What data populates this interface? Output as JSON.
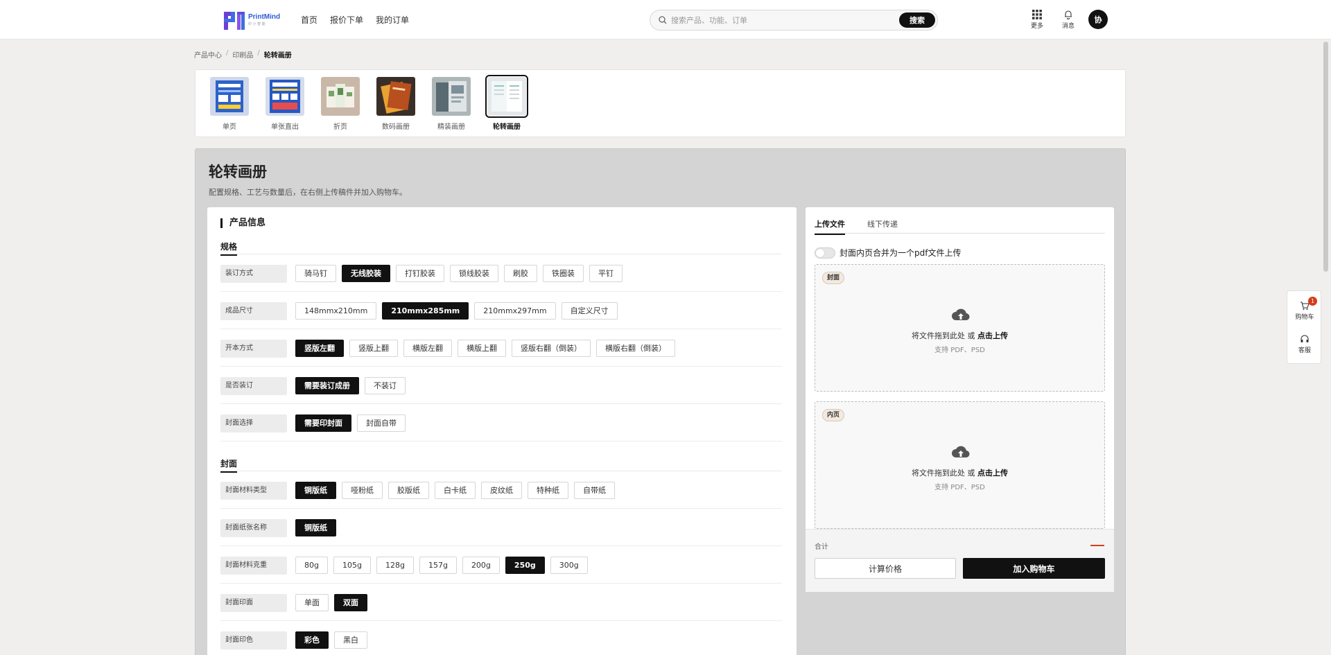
{
  "brand": {
    "name": "PrintMind",
    "tagline": "印 小 智 能"
  },
  "nav": [
    "首页",
    "报价下单",
    "我的订单"
  ],
  "search": {
    "placeholder": "搜索产品、功能、订单",
    "button": "搜索"
  },
  "header_tools": {
    "more": "更多",
    "messages": "消息",
    "avatar": "协"
  },
  "breadcrumb": [
    "产品中心",
    "印刷品",
    "轮转画册"
  ],
  "categories": [
    {
      "label": "单页"
    },
    {
      "label": "单张直出"
    },
    {
      "label": "折页"
    },
    {
      "label": "数码画册"
    },
    {
      "label": "精装画册"
    },
    {
      "label": "轮转画册",
      "active": true
    }
  ],
  "page": {
    "title": "轮转画册",
    "subtitle": "配置规格、工艺与数量后，在右侧上传稿件并加入购物车。"
  },
  "product_info": {
    "title": "产品信息",
    "groups": [
      {
        "title": "规格",
        "rows": [
          {
            "label": "装订方式",
            "options": [
              "骑马钉",
              "无线胶装",
              "打钉胶装",
              "锁线胶装",
              "刷胶",
              "铁圈装",
              "平钉"
            ],
            "selected": 1
          },
          {
            "label": "成品尺寸",
            "options": [
              "148mmx210mm",
              "210mmx285mm",
              "210mmx297mm",
              "自定义尺寸"
            ],
            "selected": 1
          },
          {
            "label": "开本方式",
            "options": [
              "竖版左翻",
              "竖版上翻",
              "横版左翻",
              "横版上翻",
              "竖版右翻（倒装）",
              "横版右翻（倒装）"
            ],
            "selected": 0
          },
          {
            "label": "是否装订",
            "options": [
              "需要装订成册",
              "不装订"
            ],
            "selected": 0
          },
          {
            "label": "封面选择",
            "options": [
              "需要印封面",
              "封面自带"
            ],
            "selected": 0
          }
        ]
      },
      {
        "title": "封面",
        "rows": [
          {
            "label": "封面材料类型",
            "options": [
              "铜版纸",
              "哑粉纸",
              "胶版纸",
              "白卡纸",
              "皮纹纸",
              "特种纸",
              "自带纸"
            ],
            "selected": 0
          },
          {
            "label": "封面纸张名称",
            "options": [
              "铜版纸"
            ],
            "selected": 0
          },
          {
            "label": "封面材料克重",
            "options": [
              "80g",
              "105g",
              "128g",
              "157g",
              "200g",
              "250g",
              "300g"
            ],
            "selected": 5
          },
          {
            "label": "封面印面",
            "options": [
              "单面",
              "双面"
            ],
            "selected": 1
          },
          {
            "label": "封面印色",
            "options": [
              "彩色",
              "黑白"
            ],
            "selected": 0
          }
        ]
      }
    ]
  },
  "upload": {
    "tabs": [
      "上传文件",
      "线下传递"
    ],
    "merge_toggle": "封面内页合并为一个pdf文件上传",
    "zones": [
      {
        "tag": "封面",
        "text": "将文件拖到此处 或 ",
        "link": "点击上传",
        "hint": "支持 PDF、PSD"
      },
      {
        "tag": "内页",
        "text": "将文件拖到此处 或 ",
        "link": "点击上传",
        "hint": "支持 PDF、PSD"
      }
    ],
    "total_label": "合计",
    "calc_button": "计算价格",
    "cart_button": "加入购物车"
  },
  "floating": {
    "cart": "购物车",
    "cart_badge": "1",
    "service": "客服"
  },
  "colors": {
    "accent": "#111111",
    "price": "#d43d1a",
    "logo": "#2b5bd7"
  }
}
